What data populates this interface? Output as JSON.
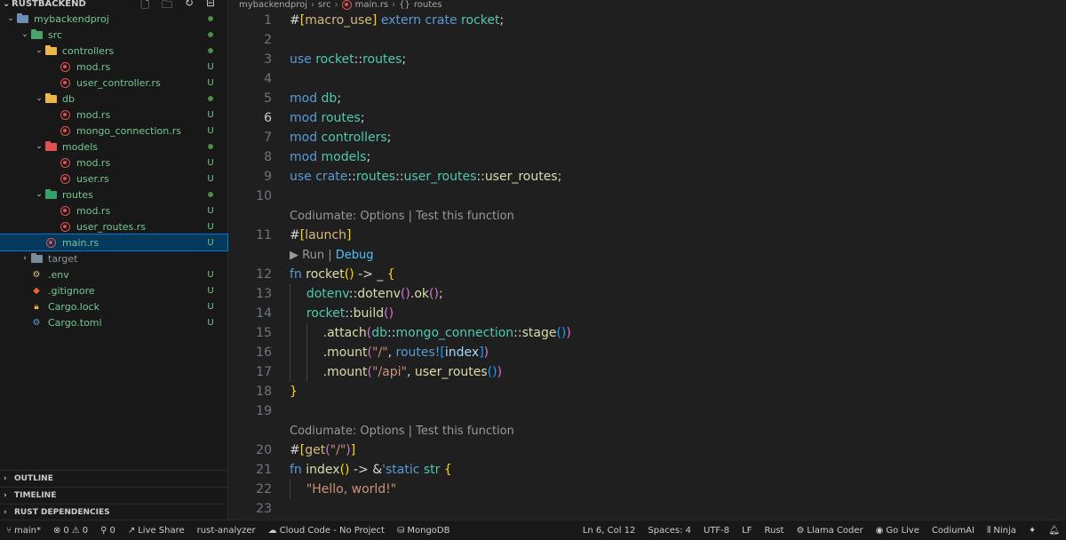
{
  "sidebar": {
    "root": "RUSTBACKEND",
    "tree": [
      {
        "label": "mybackendproj",
        "depth": 0,
        "type": "folder-proj",
        "open": true,
        "status": "dot",
        "color": "green"
      },
      {
        "label": "src",
        "depth": 1,
        "type": "folder-src",
        "open": true,
        "status": "dot",
        "color": "green"
      },
      {
        "label": "controllers",
        "depth": 2,
        "type": "folder-ctrl",
        "open": true,
        "status": "dot",
        "color": "green"
      },
      {
        "label": "mod.rs",
        "depth": 3,
        "type": "rs",
        "status": "U",
        "color": "green"
      },
      {
        "label": "user_controller.rs",
        "depth": 3,
        "type": "rs",
        "status": "U",
        "color": "green"
      },
      {
        "label": "db",
        "depth": 2,
        "type": "folder-db",
        "open": true,
        "status": "dot",
        "color": "green"
      },
      {
        "label": "mod.rs",
        "depth": 3,
        "type": "rs",
        "status": "U",
        "color": "green"
      },
      {
        "label": "mongo_connection.rs",
        "depth": 3,
        "type": "rs",
        "status": "U",
        "color": "green"
      },
      {
        "label": "models",
        "depth": 2,
        "type": "folder-models",
        "open": true,
        "status": "dot",
        "color": "green"
      },
      {
        "label": "mod.rs",
        "depth": 3,
        "type": "rs",
        "status": "U",
        "color": "green"
      },
      {
        "label": "user.rs",
        "depth": 3,
        "type": "rs",
        "status": "U",
        "color": "green"
      },
      {
        "label": "routes",
        "depth": 2,
        "type": "folder-routes",
        "open": true,
        "status": "dot",
        "color": "green"
      },
      {
        "label": "mod.rs",
        "depth": 3,
        "type": "rs",
        "status": "U",
        "color": "green"
      },
      {
        "label": "user_routes.rs",
        "depth": 3,
        "type": "rs",
        "status": "U",
        "color": "green"
      },
      {
        "label": "main.rs",
        "depth": 2,
        "type": "rs",
        "status": "U",
        "color": "green",
        "selected": true
      },
      {
        "label": "target",
        "depth": 1,
        "type": "folder-target",
        "open": false,
        "status": "",
        "color": "grey"
      },
      {
        "label": ".env",
        "depth": 1,
        "type": "env",
        "status": "U",
        "color": "green"
      },
      {
        "label": ".gitignore",
        "depth": 1,
        "type": "git",
        "status": "U",
        "color": "green"
      },
      {
        "label": "Cargo.lock",
        "depth": 1,
        "type": "lock",
        "status": "U",
        "color": "green"
      },
      {
        "label": "Cargo.toml",
        "depth": 1,
        "type": "toml",
        "status": "U",
        "color": "green"
      }
    ],
    "sections": [
      "OUTLINE",
      "TIMELINE",
      "RUST DEPENDENCIES"
    ]
  },
  "breadcrumb": [
    "mybackendproj",
    "src",
    "main.rs",
    "routes"
  ],
  "code": {
    "active_line": 6
  },
  "statusbar": {
    "branch": "main*",
    "errors": "0",
    "warnings": "0",
    "ports": "0",
    "live_share": "Live Share",
    "analyzer": "rust-analyzer",
    "cloud_code": "Cloud Code - No Project",
    "mongodb": "MongoDB",
    "position": "Ln 6, Col 12",
    "spaces": "Spaces: 4",
    "encoding": "UTF-8",
    "eol": "LF",
    "language": "Rust",
    "llama": "Llama Coder",
    "golive": "Go Live",
    "codiumai": "CodiumAI",
    "ninja": "Ninja"
  },
  "lens": {
    "codiumate": "Codiumate: Options | Test this function",
    "run": "▶ Run | Debug"
  }
}
